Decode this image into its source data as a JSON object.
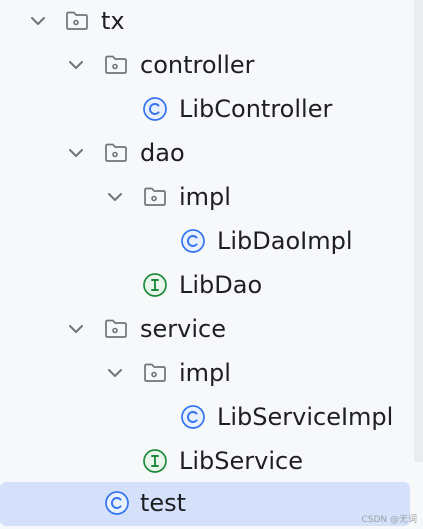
{
  "tree": {
    "items": [
      {
        "label": "tx"
      },
      {
        "label": "controller"
      },
      {
        "label": "LibController"
      },
      {
        "label": "dao"
      },
      {
        "label": "impl"
      },
      {
        "label": "LibDaoImpl"
      },
      {
        "label": "LibDao"
      },
      {
        "label": "service"
      },
      {
        "label": "impl"
      },
      {
        "label": "LibServiceImpl"
      },
      {
        "label": "LibService"
      },
      {
        "label": "test"
      }
    ]
  },
  "watermark": "CSDN @无词",
  "colors": {
    "folder_stroke": "#6f737a",
    "class_icon": "#3574f0",
    "interface_icon": "#208a3c",
    "selection": "#d5e1fb"
  }
}
